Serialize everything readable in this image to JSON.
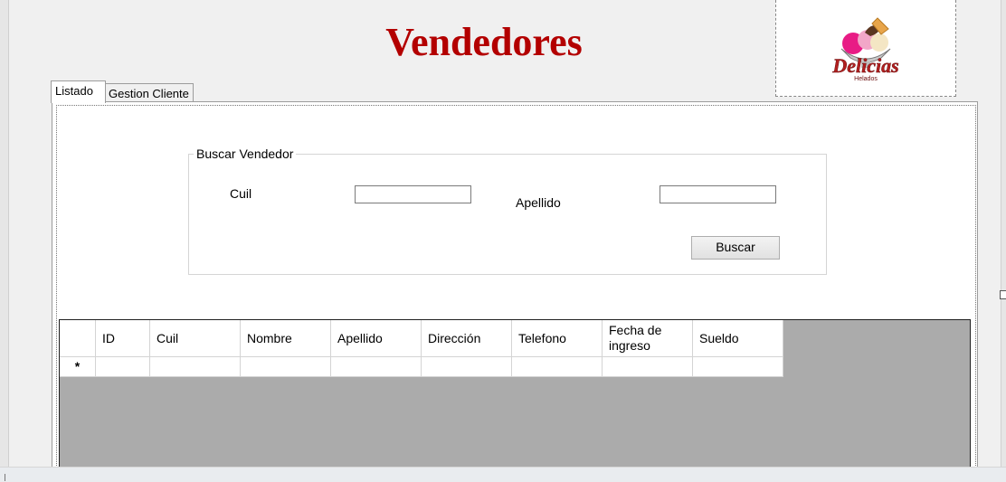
{
  "header": {
    "title": "Vendedores",
    "title_color": "#b30000"
  },
  "logo": {
    "brand": "Delicias",
    "tagline": "Helados",
    "brand_color": "#b32020"
  },
  "tabs": [
    {
      "label": "Listado",
      "active": true
    },
    {
      "label": "Gestion Cliente",
      "active": false
    }
  ],
  "search": {
    "legend": "Buscar Vendedor",
    "cuil_label": "Cuil",
    "cuil_value": "",
    "apellido_label": "Apellido",
    "apellido_value": "",
    "button_label": "Buscar"
  },
  "grid": {
    "columns": [
      "ID",
      "Cuil",
      "Nombre",
      "Apellido",
      "Dirección",
      "Telefono",
      "Fecha de ingreso",
      "Sueldo"
    ],
    "new_row_marker": "*",
    "rows": []
  }
}
